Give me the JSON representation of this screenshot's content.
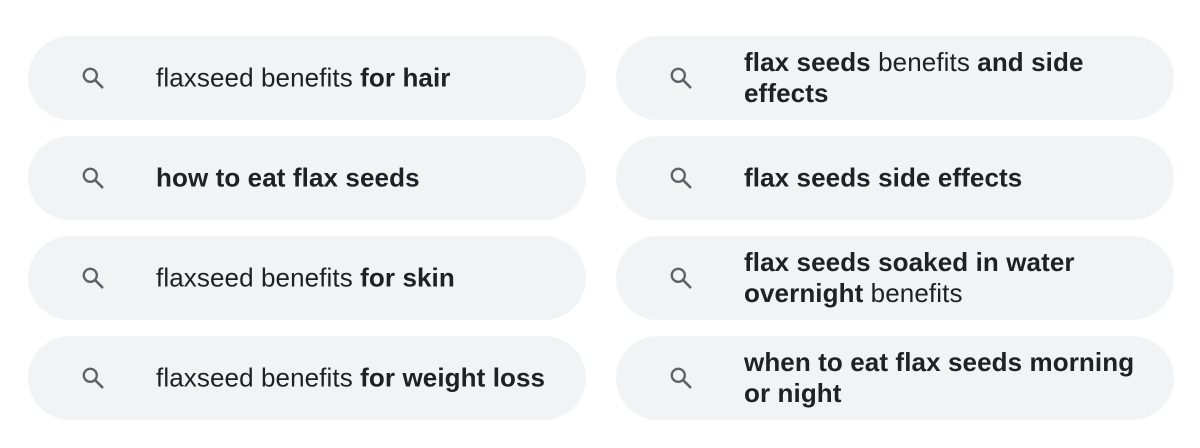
{
  "suggestions": [
    {
      "parts": [
        {
          "text": "flaxseed benefits ",
          "bold": false
        },
        {
          "text": "for hair",
          "bold": true
        }
      ],
      "icon": "search-icon"
    },
    {
      "parts": [
        {
          "text": "flax seeds",
          "bold": true
        },
        {
          "text": " benefits ",
          "bold": false
        },
        {
          "text": "and side effects",
          "bold": true
        }
      ],
      "icon": "search-icon"
    },
    {
      "parts": [
        {
          "text": "how to eat flax seeds",
          "bold": true
        }
      ],
      "icon": "search-icon"
    },
    {
      "parts": [
        {
          "text": "flax seeds side effects",
          "bold": true
        }
      ],
      "icon": "search-icon"
    },
    {
      "parts": [
        {
          "text": "flaxseed benefits ",
          "bold": false
        },
        {
          "text": "for skin",
          "bold": true
        }
      ],
      "icon": "search-icon"
    },
    {
      "parts": [
        {
          "text": "flax seeds soaked in water overnight",
          "bold": true
        },
        {
          "text": " benefits",
          "bold": false
        }
      ],
      "icon": "search-icon"
    },
    {
      "parts": [
        {
          "text": "flaxseed benefits ",
          "bold": false
        },
        {
          "text": "for weight loss",
          "bold": true
        }
      ],
      "icon": "search-icon"
    },
    {
      "parts": [
        {
          "text": "when to eat flax seeds morning or night",
          "bold": true
        }
      ],
      "icon": "search-icon"
    }
  ],
  "colors": {
    "chip_background": "#f1f3f4",
    "text": "#202124",
    "icon": "#5f6368"
  }
}
